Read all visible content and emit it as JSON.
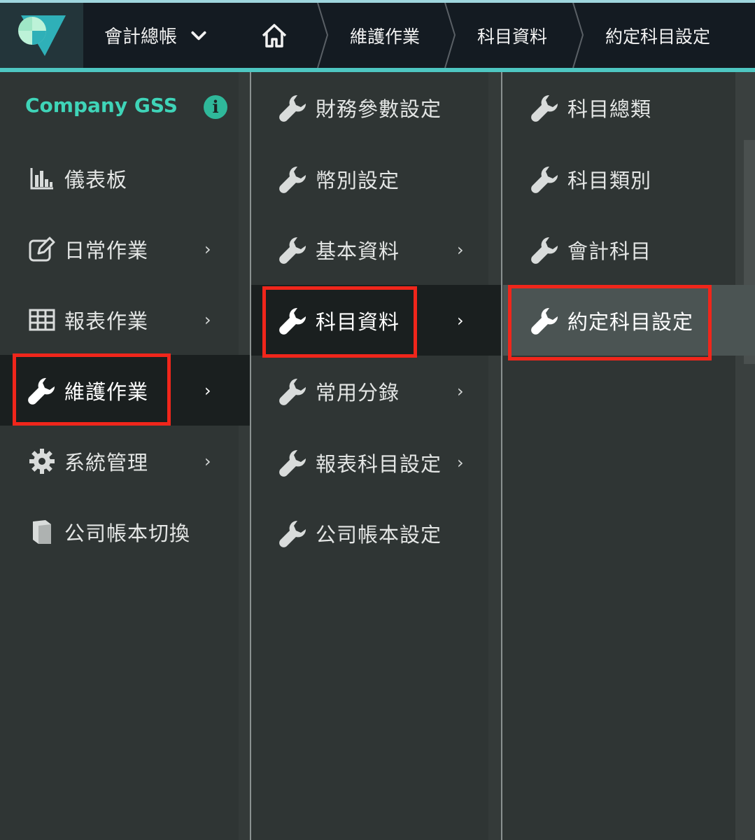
{
  "topbar": {
    "app_switch_label": "會計總帳",
    "breadcrumbs": [
      "維護作業",
      "科目資料",
      "約定科目設定"
    ]
  },
  "sidebar": {
    "company": "Company GSS",
    "items": [
      {
        "label": "儀表板",
        "icon": "bar-chart-icon"
      },
      {
        "label": "日常作業",
        "icon": "edit-icon",
        "has_submenu": true
      },
      {
        "label": "報表作業",
        "icon": "table-icon",
        "has_submenu": true
      },
      {
        "label": "維護作業",
        "icon": "wrench-icon",
        "has_submenu": true,
        "active": true
      },
      {
        "label": "系統管理",
        "icon": "gear-icon",
        "has_submenu": true
      },
      {
        "label": "公司帳本切換",
        "icon": "book-icon"
      }
    ]
  },
  "submenu": {
    "items": [
      {
        "label": "財務參數設定",
        "icon": "wrench-icon"
      },
      {
        "label": "幣別設定",
        "icon": "wrench-icon"
      },
      {
        "label": "基本資料",
        "icon": "wrench-icon",
        "has_submenu": true
      },
      {
        "label": "科目資料",
        "icon": "wrench-icon",
        "has_submenu": true,
        "active": true
      },
      {
        "label": "常用分錄",
        "icon": "wrench-icon",
        "has_submenu": true
      },
      {
        "label": "報表科目設定",
        "icon": "wrench-icon",
        "has_submenu": true
      },
      {
        "label": "公司帳本設定",
        "icon": "wrench-icon"
      }
    ]
  },
  "subsubmenu": {
    "items": [
      {
        "label": "科目總類",
        "icon": "wrench-icon"
      },
      {
        "label": "科目類別",
        "icon": "wrench-icon"
      },
      {
        "label": "會計科目",
        "icon": "wrench-icon"
      },
      {
        "label": "約定科目設定",
        "icon": "wrench-icon",
        "highlighted": true
      }
    ]
  },
  "colors": {
    "accent": "#4ec7c2",
    "company": "#3fd4b8",
    "highlight_box": "#f0261b"
  }
}
